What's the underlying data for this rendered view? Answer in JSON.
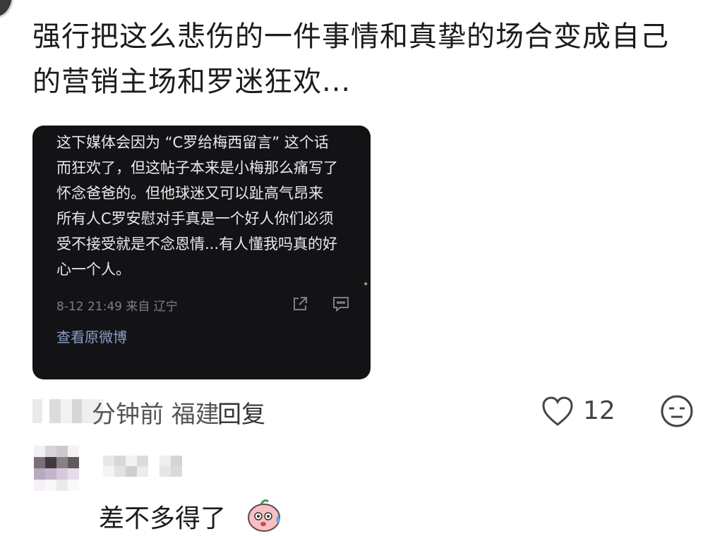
{
  "comment": {
    "text": "强行把这么悲伤的一件事情和真挚的场合变成自己的营销主场和罗迷狂欢..."
  },
  "quote_card": {
    "lines": [
      "这下媒体会因为 “C罗给梅西留言” 这个话",
      "而狂欢了，但这帖子本来是小梅那么痛写了",
      "怀念爸爸的。但他球迷又可以趾高气昂来",
      "所有人C罗安慰对手真是一个好人你们必须",
      "受不接受就是不念恩情...有人懂我吗真的好",
      "心一个人。"
    ],
    "meta": "8-12 21:49 来自 辽宁",
    "view_original": "查看原微博",
    "icons": [
      "share-icon",
      "comment-icon"
    ]
  },
  "footer": {
    "time": "分钟前 福建",
    "reply": "回复",
    "like_count": "12",
    "icons": [
      "heart-icon",
      "emoji-face-icon"
    ]
  },
  "reply": {
    "text": "差不多得了"
  },
  "colors": {
    "card_bg": "#131316",
    "card_text": "#e9e9ec",
    "link": "#8b9fc6",
    "meta": "#7c7f87"
  }
}
